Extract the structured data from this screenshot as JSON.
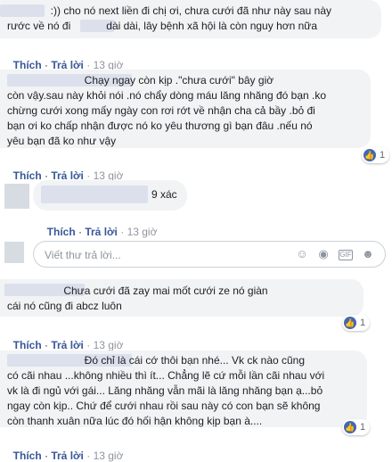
{
  "comments": [
    {
      "lines": [
        "  :)) cho nó next liền đi chị ơi, chưa cưới đã như này sau này",
        "rước về nó đi            dài dài, lây bệnh xã hội là còn nguy hơn nữa"
      ],
      "like": "Thích",
      "reply": "Trả lời",
      "time": "13 giờ"
    },
    {
      "lines": [
        "                          Chạy ngay còn kịp .\"chưa cưới\" bây giờ",
        "còn vậy.sau này khỏi nói .nó chẩy dòng máu lăng nhăng đó bạn .ko",
        "chừng cưới xong mấy ngày con rơi rớt về nhận cha cả bầy .bỏ đi",
        "bạn ơi ko chấp nhận được nó ko yêu thương gì bạn đâu .nếu nó",
        "yêu bạn đã ko như vậy"
      ],
      "like": "Thích",
      "reply": "Trả lời",
      "time": "13 giờ",
      "reaction_count": "1"
    },
    {
      "lines": [
        "9 xác"
      ],
      "like": "Thích",
      "reply": "Trả lời",
      "time": "13 giờ"
    },
    {
      "lines": [
        "                   Chưa cưới đã zay mai mốt cưới ze nó giàn",
        "cái nó cũng đi abcz luôn"
      ],
      "like": "Thích",
      "reply": "Trả lời",
      "time": "13 giờ",
      "reaction_count": "1"
    },
    {
      "lines": [
        "                          Đó chỉ là cái cớ thôi bạn nhé... Vk ck nào cũng",
        "có cãi nhau ...không nhiều thì ít... Chẳng lẽ cứ mỗi lần cãi nhau với",
        "vk là đi ngủ với gái... Lăng nhăng vẫn mãi là lăng nhăng bạn ạ...bỏ",
        "ngay còn kịp.. Chứ để cưới nhau rồi sau này có con bạn sẽ không",
        "còn thanh xuân nữa lúc đó hối hận không kịp bạn à...."
      ],
      "like": "Thích",
      "reply": "Trả lời",
      "time": "13 giờ",
      "reaction_count": "1"
    }
  ],
  "reply_box": {
    "placeholder": "Viết thư trả lời...",
    "icons": [
      "emoji-icon",
      "camera-icon",
      "gif-icon",
      "sticker-icon"
    ]
  }
}
